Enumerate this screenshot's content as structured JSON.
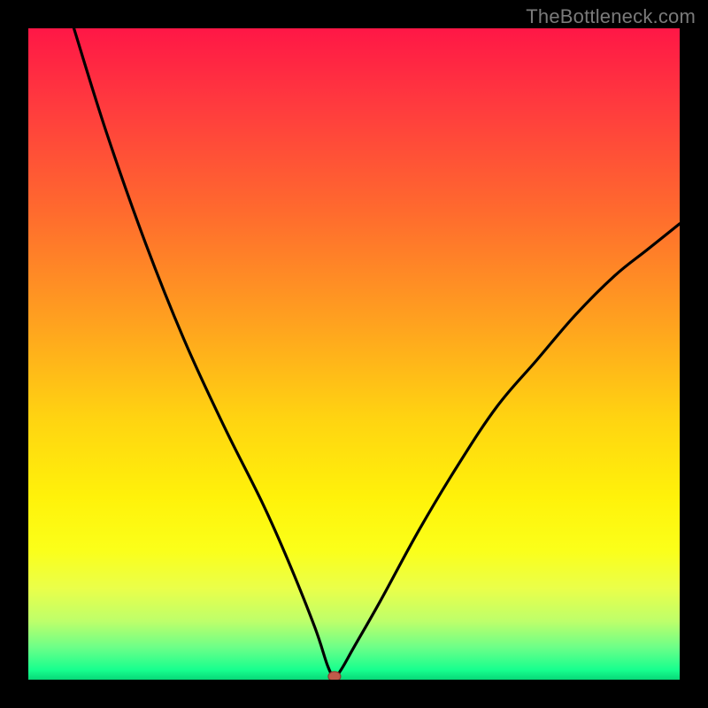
{
  "watermark": "TheBottleneck.com",
  "colors": {
    "frame": "#000000",
    "curve": "#000000",
    "marker_fill": "#c05a4a",
    "marker_stroke": "#8a3a30",
    "gradient": [
      {
        "offset": 0.0,
        "color": "#ff1746"
      },
      {
        "offset": 0.12,
        "color": "#ff3b3e"
      },
      {
        "offset": 0.28,
        "color": "#ff6a2e"
      },
      {
        "offset": 0.45,
        "color": "#ffa11f"
      },
      {
        "offset": 0.6,
        "color": "#ffd411"
      },
      {
        "offset": 0.72,
        "color": "#fff20a"
      },
      {
        "offset": 0.8,
        "color": "#fbff19"
      },
      {
        "offset": 0.86,
        "color": "#eaff4a"
      },
      {
        "offset": 0.91,
        "color": "#beff6a"
      },
      {
        "offset": 0.95,
        "color": "#6dff88"
      },
      {
        "offset": 0.985,
        "color": "#17ff8e"
      },
      {
        "offset": 1.0,
        "color": "#08d878"
      }
    ]
  },
  "chart_data": {
    "type": "line",
    "title": "",
    "xlabel": "",
    "ylabel": "",
    "xlim": [
      0,
      100
    ],
    "ylim": [
      0,
      100
    ],
    "grid": false,
    "legend": false,
    "note": "V-shaped bottleneck curve; minimum (≈0) at x≈47. Left branch starts near y≈100 at x≈7 and descends with decreasing steepness to the minimum; right branch rises concavely to y≈70 at x≈100.",
    "x": [
      7,
      12,
      18,
      24,
      30,
      36,
      40,
      44,
      46,
      47,
      48,
      50,
      54,
      60,
      66,
      72,
      78,
      84,
      90,
      95,
      100
    ],
    "y": [
      100,
      84,
      67,
      52,
      39,
      27,
      18,
      8,
      2,
      0.5,
      1.5,
      5,
      12,
      23,
      33,
      42,
      49,
      56,
      62,
      66,
      70
    ],
    "marker": {
      "x": 47,
      "y": 0.5
    }
  }
}
